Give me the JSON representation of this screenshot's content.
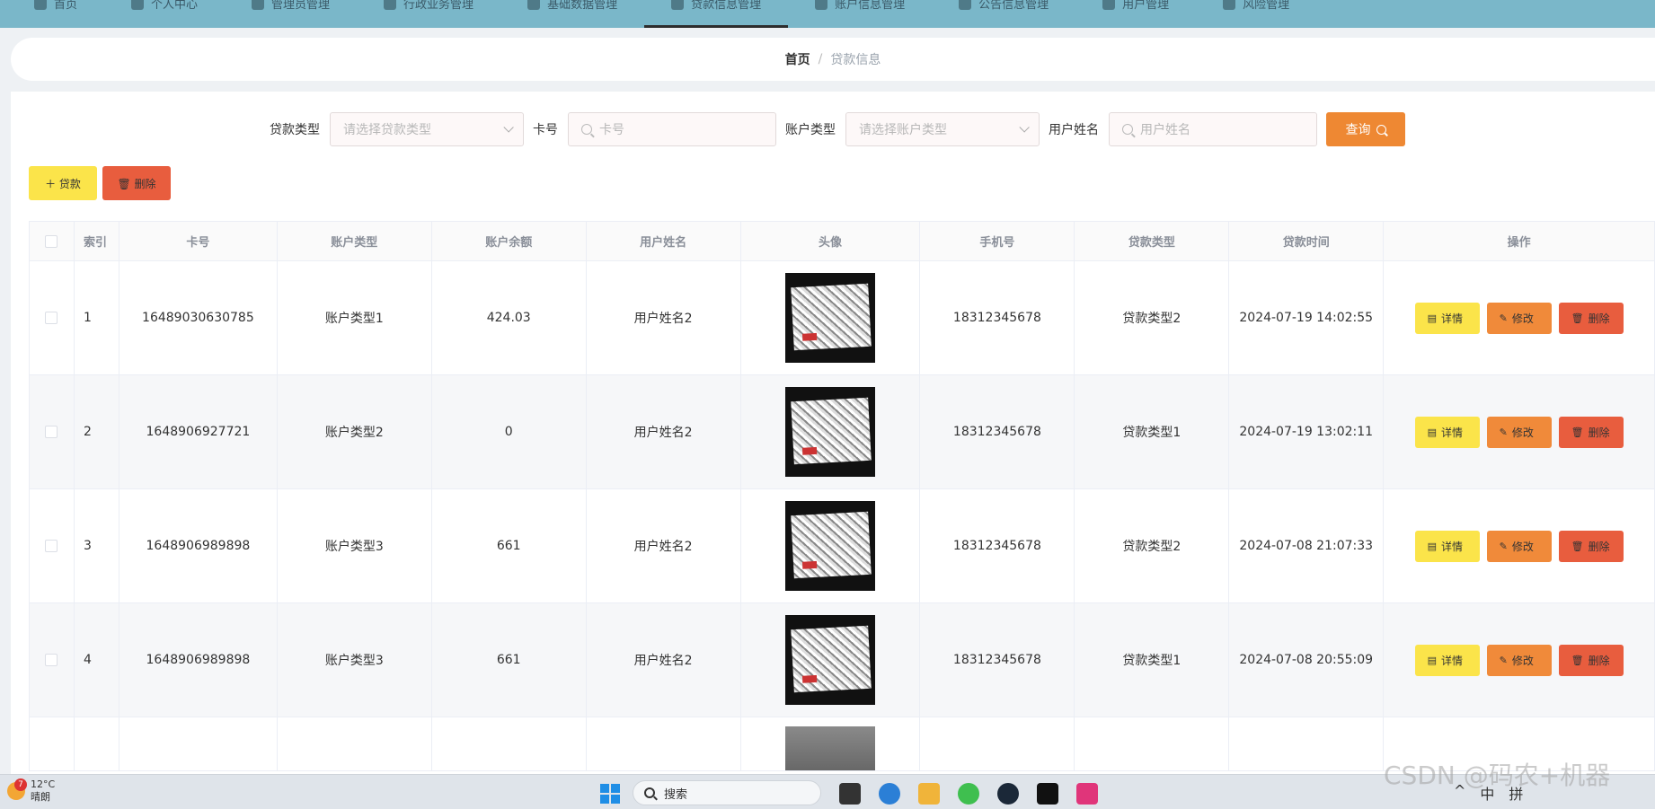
{
  "nav": {
    "items": [
      {
        "label": "首页"
      },
      {
        "label": "个人中心"
      },
      {
        "label": "管理员管理"
      },
      {
        "label": "行政业务管理"
      },
      {
        "label": "基础数据管理"
      },
      {
        "label": "贷款信息管理"
      },
      {
        "label": "账户信息管理"
      },
      {
        "label": "公告信息管理"
      },
      {
        "label": "用户管理"
      },
      {
        "label": "风险管理"
      }
    ],
    "active_index": 5
  },
  "breadcrumb": {
    "home": "首页",
    "separator": "/",
    "current": "贷款信息"
  },
  "search": {
    "loan_type_label": "贷款类型",
    "loan_type_placeholder": "请选择贷款类型",
    "card_label": "卡号",
    "card_placeholder": "卡号",
    "account_type_label": "账户类型",
    "account_type_placeholder": "请选择账户类型",
    "username_label": "用户姓名",
    "username_placeholder": "用户姓名",
    "query_label": "查询"
  },
  "actions": {
    "add_label": "贷款",
    "delete_label": "删除"
  },
  "table": {
    "headers": {
      "index": "索引",
      "card": "卡号",
      "account_type": "账户类型",
      "balance": "账户余额",
      "username": "用户姓名",
      "avatar": "头像",
      "phone": "手机号",
      "loan_type": "贷款类型",
      "loan_time": "贷款时间",
      "ops": "操作"
    },
    "rows": [
      {
        "index": "1",
        "card": "16489030630785",
        "account_type": "账户类型1",
        "balance": "424.03",
        "username": "用户姓名2",
        "phone": "18312345678",
        "loan_type": "贷款类型2",
        "loan_time": "2024-07-19 14:02:55"
      },
      {
        "index": "2",
        "card": "1648906927721",
        "account_type": "账户类型2",
        "balance": "0",
        "username": "用户姓名2",
        "phone": "18312345678",
        "loan_type": "贷款类型1",
        "loan_time": "2024-07-19 13:02:11"
      },
      {
        "index": "3",
        "card": "1648906989898",
        "account_type": "账户类型3",
        "balance": "661",
        "username": "用户姓名2",
        "phone": "18312345678",
        "loan_type": "贷款类型2",
        "loan_time": "2024-07-08 21:07:33"
      },
      {
        "index": "4",
        "card": "1648906989898",
        "account_type": "账户类型3",
        "balance": "661",
        "username": "用户姓名2",
        "phone": "18312345678",
        "loan_type": "贷款类型1",
        "loan_time": "2024-07-08 20:55:09"
      }
    ],
    "row_ops": {
      "detail": "详情",
      "edit": "修改",
      "delete": "删除"
    }
  },
  "taskbar": {
    "weather_badge": "7",
    "temperature": "12°C",
    "condition": "晴朗",
    "search_placeholder": "搜索",
    "tray_chevron": "^",
    "tray_lang1": "中",
    "tray_lang2": "拼"
  },
  "watermark": "CSDN @码农+机器"
}
